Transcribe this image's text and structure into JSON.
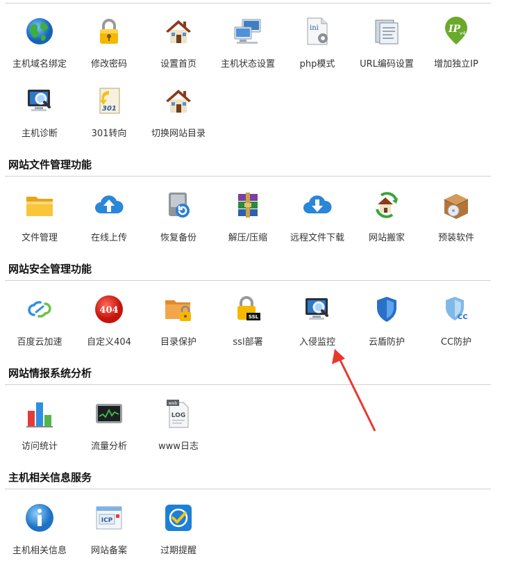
{
  "sections": {
    "host": {
      "items": [
        {
          "label": "主机域名绑定",
          "icon": "globe-icon"
        },
        {
          "label": "修改密码",
          "icon": "padlock-icon"
        },
        {
          "label": "设置首页",
          "icon": "house-icon"
        },
        {
          "label": "主机状态设置",
          "icon": "network-computers-icon"
        },
        {
          "label": "php模式",
          "icon": "ini-settings-icon"
        },
        {
          "label": "URL编码设置",
          "icon": "url-document-icon"
        },
        {
          "label": "增加独立IP",
          "icon": "ipv4-badge-icon"
        },
        {
          "label": "主机诊断",
          "icon": "monitor-magnifier-icon"
        },
        {
          "label": "301转向",
          "icon": "redirect-301-icon"
        },
        {
          "label": "切换网站目录",
          "icon": "house-icon"
        }
      ]
    },
    "files": {
      "title": "网站文件管理功能",
      "items": [
        {
          "label": "文件管理",
          "icon": "folder-icon"
        },
        {
          "label": "在线上传",
          "icon": "cloud-upload-icon"
        },
        {
          "label": "恢复备份",
          "icon": "disk-restore-icon"
        },
        {
          "label": "解压/压缩",
          "icon": "archive-books-icon"
        },
        {
          "label": "远程文件下载",
          "icon": "cloud-download-icon"
        },
        {
          "label": "网站搬家",
          "icon": "house-move-icon"
        },
        {
          "label": "预装软件",
          "icon": "software-box-icon"
        }
      ]
    },
    "security": {
      "title": "网站安全管理功能",
      "items": [
        {
          "label": "百度云加速",
          "icon": "cloud-accelerate-icon"
        },
        {
          "label": "自定义404",
          "icon": "error-404-icon"
        },
        {
          "label": "目录保护",
          "icon": "folder-lock-icon"
        },
        {
          "label": "ssl部署",
          "icon": "ssl-lock-icon"
        },
        {
          "label": "入侵监控",
          "icon": "monitor-magnifier-icon"
        },
        {
          "label": "云盾防护",
          "icon": "shield-icon"
        },
        {
          "label": "CC防护",
          "icon": "cc-shield-icon"
        }
      ]
    },
    "analytics": {
      "title": "网站情报系统分析",
      "items": [
        {
          "label": "访问统计",
          "icon": "bar-chart-icon"
        },
        {
          "label": "流量分析",
          "icon": "traffic-monitor-icon"
        },
        {
          "label": "www日志",
          "icon": "web-log-icon"
        }
      ]
    },
    "info": {
      "title": "主机相关信息服务",
      "items": [
        {
          "label": "主机相关信息",
          "icon": "info-icon"
        },
        {
          "label": "网站备案",
          "icon": "icp-icon"
        },
        {
          "label": "过期提醒",
          "icon": "expiry-check-icon"
        }
      ]
    }
  },
  "colors": {
    "annotation_arrow": "#e8392f",
    "rule": "#cfcfcf"
  }
}
